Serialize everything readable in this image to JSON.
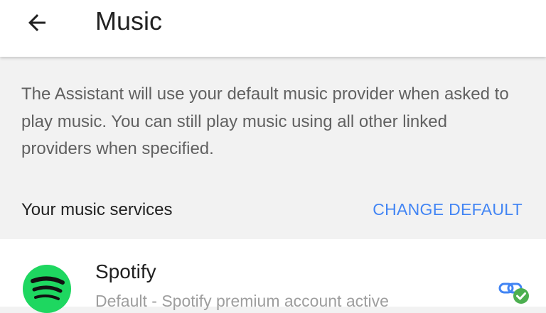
{
  "header": {
    "title": "Music",
    "back_icon": "arrow-back-icon"
  },
  "description": "The Assistant will use your default music provider when asked to play music. You can still play music using all other linked providers when specified.",
  "section": {
    "label": "Your music services",
    "action_label": "CHANGE DEFAULT"
  },
  "providers": [
    {
      "name": "Spotify",
      "status": "Default - Spotify premium account active",
      "icon": "spotify-icon",
      "linked_icon": "link-check-icon"
    }
  ],
  "colors": {
    "accent": "#4285f4",
    "spotify": "#1ed760",
    "linked_check": "#4caf50"
  }
}
